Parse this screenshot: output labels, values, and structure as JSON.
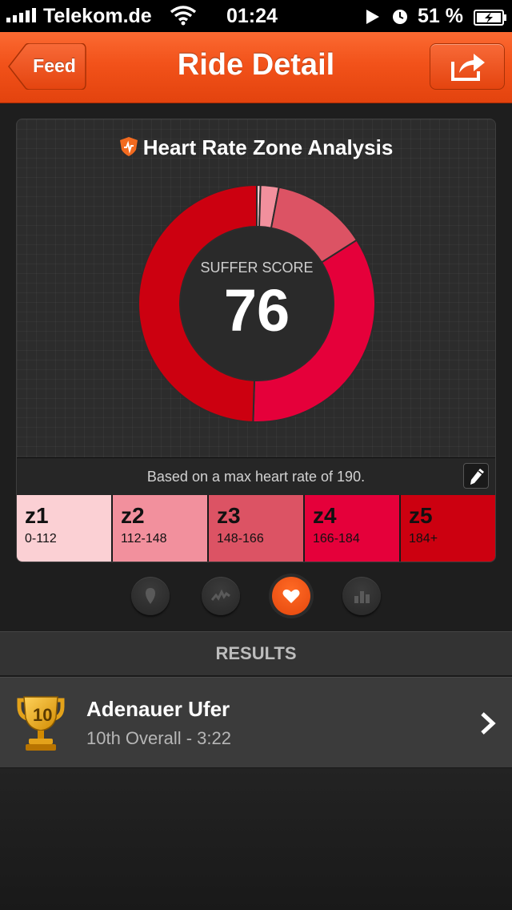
{
  "status_bar": {
    "carrier": "Telekom.de",
    "time": "01:24",
    "battery": "51 %"
  },
  "nav": {
    "back_label": "Feed",
    "title": "Ride Detail"
  },
  "card": {
    "title": "Heart Rate Zone Analysis",
    "score_label": "SUFFER SCORE",
    "score": "76",
    "max_hr_text": "Based on a max heart rate of 190."
  },
  "chart_data": {
    "type": "pie",
    "title": "Heart Rate Zone Analysis",
    "slices": [
      {
        "zone": "z1",
        "percent": 0.5,
        "color": "#f9c6cc"
      },
      {
        "zone": "z2",
        "percent": 2.5,
        "color": "#f2909d"
      },
      {
        "zone": "z3",
        "percent": 13.0,
        "color": "#dc5364"
      },
      {
        "zone": "z4",
        "percent": 34.5,
        "color": "#e5003a"
      },
      {
        "zone": "z5",
        "percent": 49.5,
        "color": "#cc0010"
      }
    ]
  },
  "zones": [
    {
      "name": "z1",
      "range": "0-112",
      "color": "#fbd0d4"
    },
    {
      "name": "z2",
      "range": "112-148",
      "color": "#f2909d"
    },
    {
      "name": "z3",
      "range": "148-166",
      "color": "#dc5364"
    },
    {
      "name": "z4",
      "range": "166-184",
      "color": "#e5003a"
    },
    {
      "name": "z5",
      "range": "184+",
      "color": "#cc0010"
    }
  ],
  "tabs": [
    {
      "icon": "map-pin-icon",
      "active": false
    },
    {
      "icon": "pulse-icon",
      "active": false
    },
    {
      "icon": "heart-icon",
      "active": true
    },
    {
      "icon": "bar-chart-icon",
      "active": false
    }
  ],
  "results": {
    "header": "RESULTS",
    "items": [
      {
        "trophy": "10",
        "name": "Adenauer Ufer",
        "detail": "10th Overall - 3:22"
      }
    ]
  },
  "colors": {
    "accent": "#f2521a",
    "card_bg": "#2c2c2c"
  }
}
